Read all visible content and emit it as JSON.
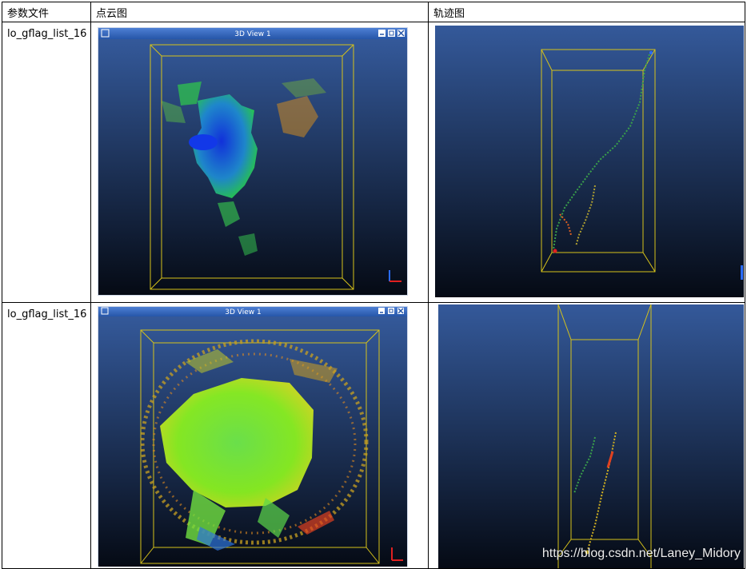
{
  "table": {
    "headers": [
      "参数文件",
      "点云图",
      "轨迹图"
    ],
    "rows": [
      {
        "param_file": "lo_gflag_list_16",
        "window_title": "3D View 1"
      },
      {
        "param_file": "lo_gflag_list_16",
        "window_title": "3D View 1"
      }
    ]
  },
  "watermark": "https://blog.csdn.net/Laney_Midory",
  "colors": {
    "titlebar": "#2c5fb5",
    "viewport_top": "#34599a",
    "viewport_bottom": "#050a14",
    "bounding_box": "#d6c21a",
    "axis_x": "#e02020",
    "axis_y": "#2a6cff"
  },
  "icons": [
    "window-menu-icon",
    "minimize-icon",
    "restore-icon",
    "close-icon",
    "axis-gizmo-icon"
  ]
}
